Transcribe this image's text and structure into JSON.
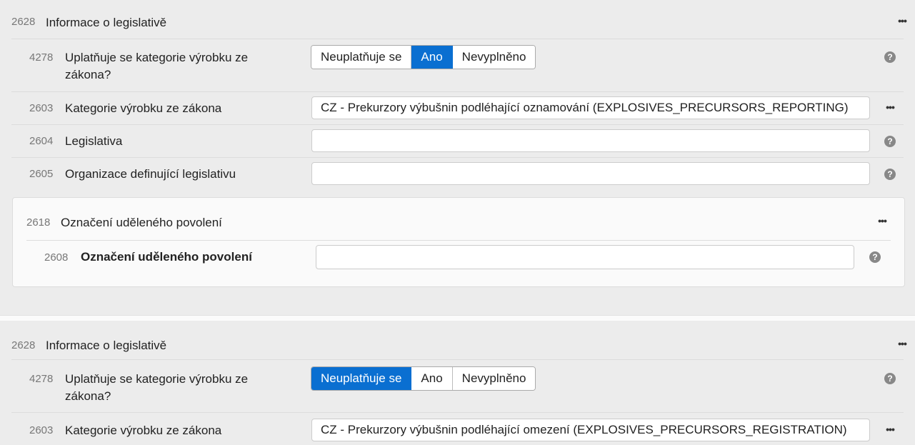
{
  "blocks": [
    {
      "header": {
        "code": "2628",
        "title": "Informace o legislativě"
      },
      "rows": [
        {
          "code": "4278",
          "label": "Uplatňuje se kategorie výrobku ze zákona?",
          "options": [
            "Neuplatňuje se",
            "Ano",
            "Nevyplněno"
          ],
          "selected": "Ano"
        },
        {
          "code": "2603",
          "label": "Kategorie výrobku ze zákona",
          "value": "CZ - Prekurzory výbušnin podléhající oznamování (EXPLOSIVES_PRECURSORS_REPORTING)"
        },
        {
          "code": "2604",
          "label": "Legislativa",
          "value": ""
        },
        {
          "code": "2605",
          "label": "Organizace definující legislativu",
          "value": ""
        }
      ],
      "subgroup": {
        "code": "2618",
        "title": "Označení uděleného povolení",
        "row": {
          "code": "2608",
          "label": "Označení uděleného povolení",
          "value": ""
        }
      }
    },
    {
      "header": {
        "code": "2628",
        "title": "Informace o legislativě"
      },
      "rows": [
        {
          "code": "4278",
          "label": "Uplatňuje se kategorie výrobku ze zákona?",
          "options": [
            "Neuplatňuje se",
            "Ano",
            "Nevyplněno"
          ],
          "selected": "Neuplatňuje se"
        },
        {
          "code": "2603",
          "label": "Kategorie výrobku ze zákona",
          "value": "CZ - Prekurzory výbušnin podléhající omezení (EXPLOSIVES_PRECURSORS_REGISTRATION)"
        }
      ]
    }
  ],
  "icons": {
    "more": "more-horizontal-icon",
    "help": "question-circle-icon"
  },
  "colors": {
    "active_button": "#0a6fd1",
    "background": "#ececec"
  }
}
